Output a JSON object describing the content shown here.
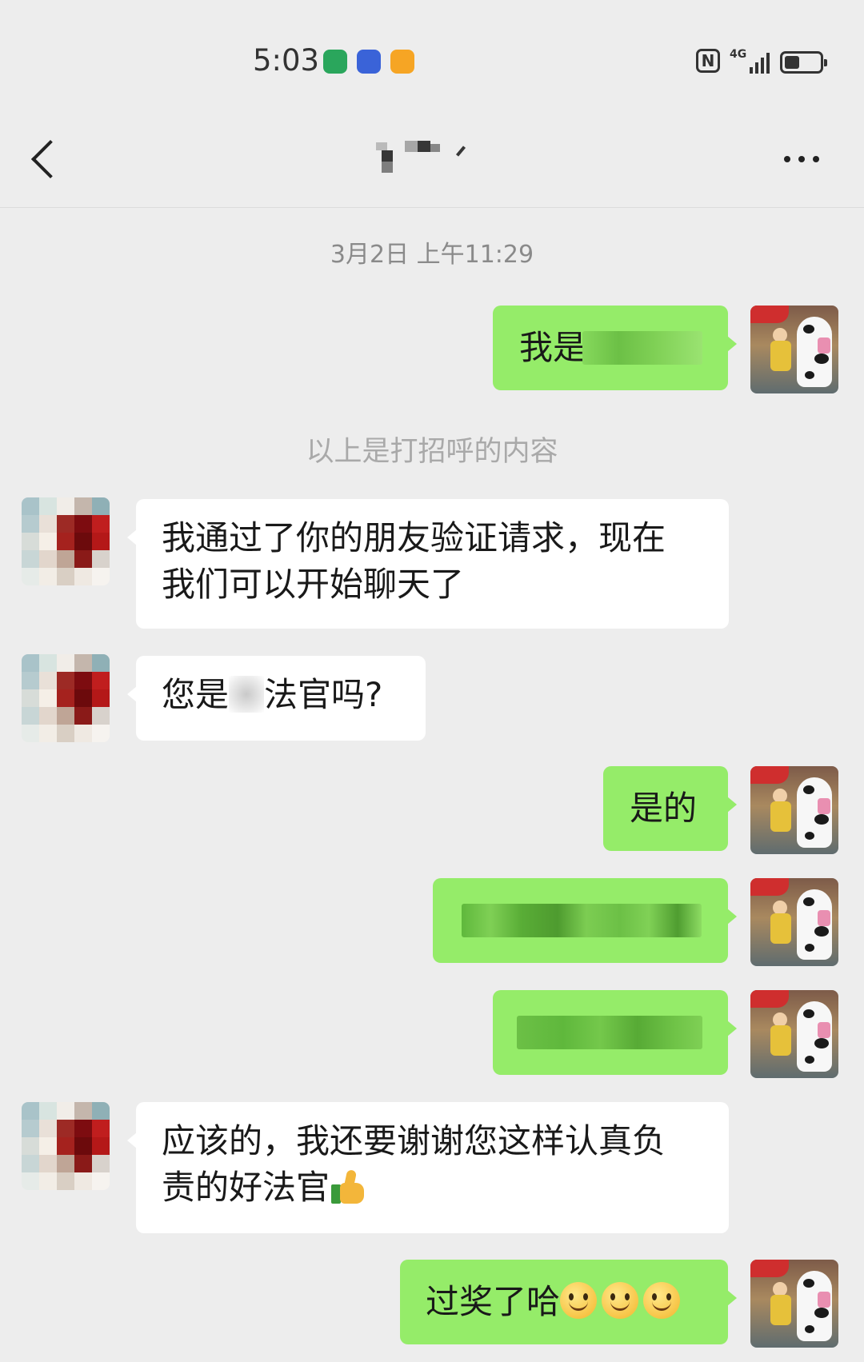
{
  "status_bar": {
    "time": "5:03",
    "network_label": "4G",
    "nfc_label": "N",
    "app_icons": [
      {
        "icon": "chat-app-icon",
        "color": "#2aa65c"
      },
      {
        "icon": "music-app-icon",
        "color": "#3a63d8"
      },
      {
        "icon": "cup-app-icon",
        "color": "#f6a524"
      }
    ]
  },
  "header": {
    "back_icon": "chevron-left-icon",
    "more_icon": "more-dots-icon"
  },
  "chat": {
    "time_divider": "3月2日 上午11:29",
    "greeting_note": "以上是打招呼的内容",
    "messages": [
      {
        "sender": "self",
        "text": "我是"
      },
      {
        "sender": "other",
        "text": "我通过了你的朋友验证请求，现在\n我们可以开始聊天了"
      },
      {
        "sender": "other",
        "text_before": "您是",
        "text_after": "法官吗?"
      },
      {
        "sender": "self",
        "text": "是的"
      },
      {
        "sender": "self",
        "text": ""
      },
      {
        "sender": "self",
        "text": ""
      },
      {
        "sender": "other",
        "text": "应该的，我还要谢谢您这样认真负\n责的好法官",
        "emoji": "thumbs-up-icon"
      },
      {
        "sender": "self",
        "text": "过奖了哈",
        "emoji": "smile-emoji-icon",
        "emoji_count": 3
      }
    ]
  },
  "colors": {
    "background": "#ededed",
    "self_bubble": "#95ec69",
    "other_bubble": "#ffffff",
    "meta_text": "#8a8a8a"
  }
}
